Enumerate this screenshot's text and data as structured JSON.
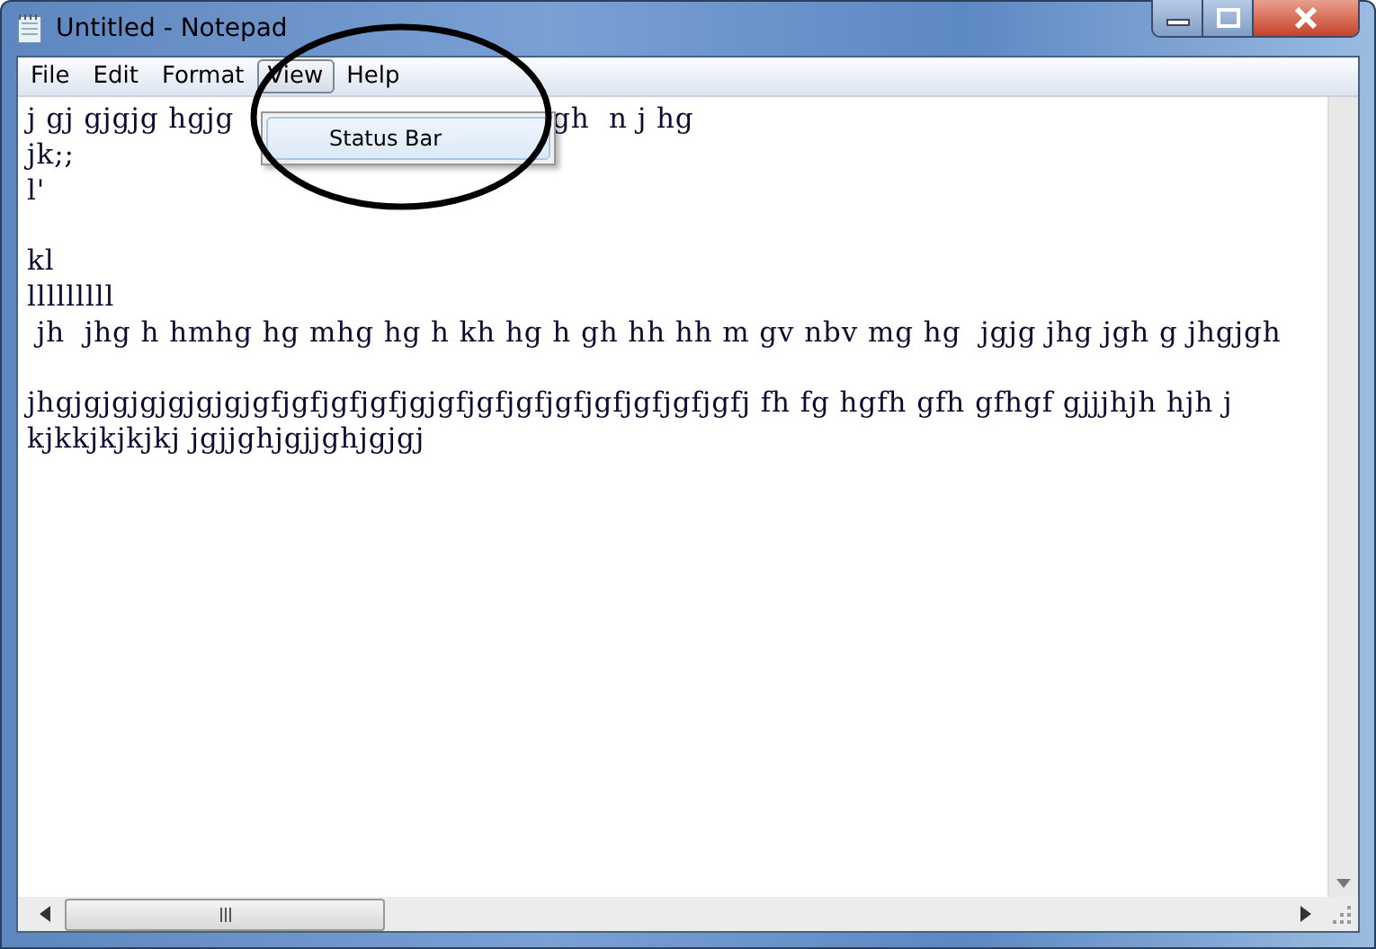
{
  "window": {
    "title": "Untitled - Notepad"
  },
  "menu_bar": [
    {
      "label": "File",
      "selected": false
    },
    {
      "label": "Edit",
      "selected": false
    },
    {
      "label": "Format",
      "selected": false
    },
    {
      "label": "View",
      "selected": true
    },
    {
      "label": "Help",
      "selected": false
    }
  ],
  "open_menu": {
    "items": [
      {
        "label": "Status Bar",
        "checked": false
      }
    ]
  },
  "editor": {
    "paragraphs": [
      [
        [
          "j gj gjgjg hgjg",
          "gh  n j hg"
        ],
        [
          "jk;;"
        ],
        [
          "l'"
        ]
      ],
      [
        [
          "kl"
        ],
        [
          "lllllllll"
        ],
        [
          " jh  jhg h hmhg hg mhg hg h kh hg h gh hh hh m gv nbv mg hg  jgjg jhg jgh g jhgjgh"
        ]
      ],
      [
        [
          "jhgjgjgjgjgjgjgjgfjgfjgfjgfjgjgfjgfjgfjgfjgfjgfjgfjgfj fh fg hgfh gfh gfhgf gjjjhjh hjh j"
        ],
        [
          "kjkkjkjkjkj jgjjghjgjjghjgjgj"
        ]
      ]
    ]
  },
  "annotation": {
    "kind": "ellipse"
  }
}
